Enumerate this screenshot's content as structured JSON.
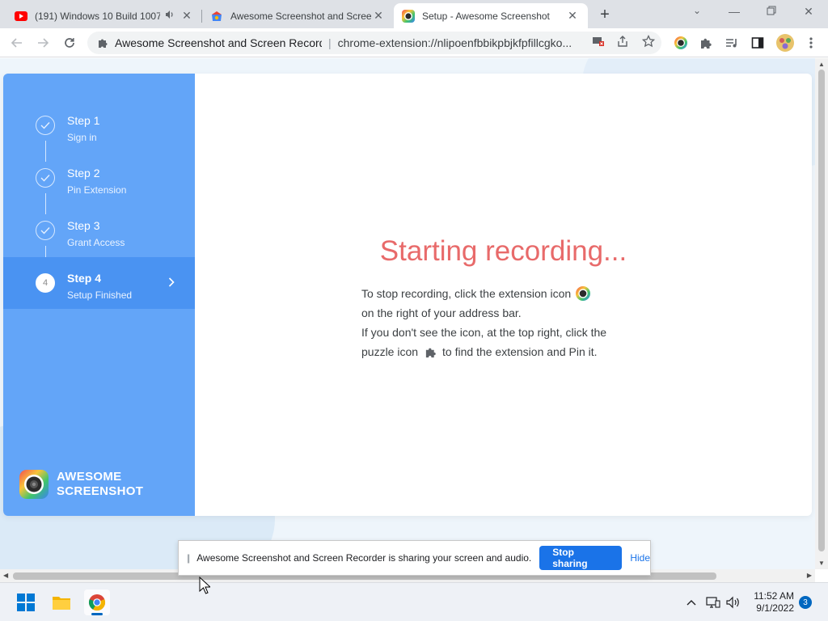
{
  "browser": {
    "tabs": [
      {
        "title": "(191) Windows 10 Build 1007",
        "icon": "youtube-icon"
      },
      {
        "title": "Awesome Screenshot and Screen",
        "icon": "webstore-icon"
      },
      {
        "title": "Setup - Awesome Screenshot",
        "icon": "awesome-screenshot-icon",
        "active": true
      }
    ],
    "site_label": "Awesome Screenshot and Screen Recorde",
    "url": "chrome-extension://nlipoenfbbikpbjkfpfillcgko..."
  },
  "sidebar": {
    "steps": [
      {
        "title": "Step 1",
        "subtitle": "Sign in",
        "state": "done"
      },
      {
        "title": "Step 2",
        "subtitle": "Pin Extension",
        "state": "done"
      },
      {
        "title": "Step 3",
        "subtitle": "Grant Access",
        "state": "done"
      },
      {
        "title": "Step 4",
        "subtitle": "Setup Finished",
        "state": "active",
        "number": "4"
      }
    ],
    "logo_line1": "AWESOME",
    "logo_line2": "SCREENSHOT"
  },
  "main": {
    "heading": "Starting recording...",
    "line1": "To stop recording, click the extension icon",
    "line2": "on the right of your address bar.",
    "line3": "If you don't see the icon, at the top right, click the",
    "line4a": "puzzle icon",
    "line4b": "to find the extension and Pin it."
  },
  "sharebar": {
    "message": "Awesome Screenshot and Screen Recorder is sharing your screen and audio.",
    "stop_label": "Stop sharing",
    "hide_label": "Hide"
  },
  "taskbar": {
    "time": "11:52 AM",
    "date": "9/1/2022",
    "notification_count": "3"
  },
  "colors": {
    "sidebar": "#63a5f8",
    "sidebar_active": "#4a93f2",
    "heading": "#e86a6a",
    "accent": "#1a73e8"
  }
}
